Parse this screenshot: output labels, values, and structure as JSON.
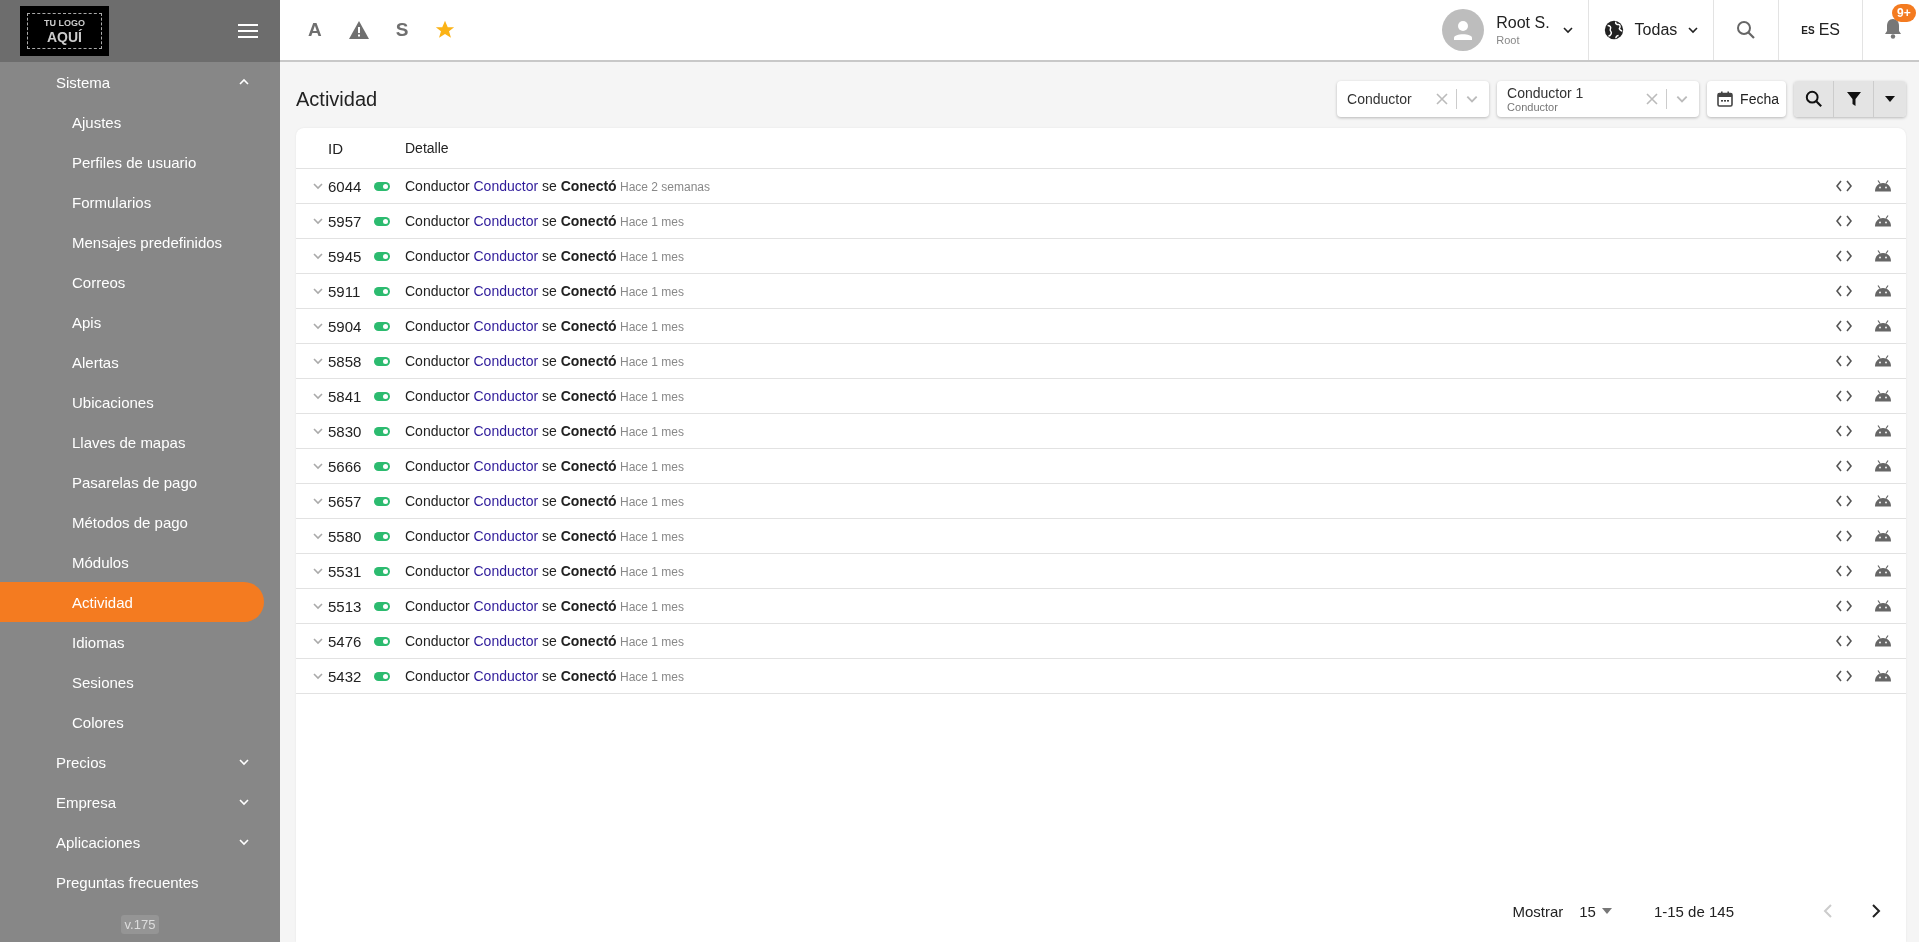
{
  "sidebar": {
    "logo": [
      "TU LOGO",
      "AQUÍ"
    ],
    "items": [
      {
        "kind": "group",
        "label": "Sistema",
        "expanded": true,
        "children": [
          {
            "label": "Ajustes",
            "selected": false
          },
          {
            "label": "Perfiles de usuario",
            "selected": false
          },
          {
            "label": "Formularios",
            "selected": false
          },
          {
            "label": "Mensajes predefinidos",
            "selected": false
          },
          {
            "label": "Correos",
            "selected": false
          },
          {
            "label": "Apis",
            "selected": false
          },
          {
            "label": "Alertas",
            "selected": false
          },
          {
            "label": "Ubicaciones",
            "selected": false
          },
          {
            "label": "Llaves de mapas",
            "selected": false
          },
          {
            "label": "Pasarelas de pago",
            "selected": false
          },
          {
            "label": "Métodos de pago",
            "selected": false
          },
          {
            "label": "Módulos",
            "selected": false
          },
          {
            "label": "Actividad",
            "selected": true
          },
          {
            "label": "Idiomas",
            "selected": false
          },
          {
            "label": "Sesiones",
            "selected": false
          },
          {
            "label": "Colores",
            "selected": false
          }
        ]
      },
      {
        "kind": "group",
        "label": "Precios",
        "expanded": false
      },
      {
        "kind": "group",
        "label": "Empresa",
        "expanded": false
      },
      {
        "kind": "group",
        "label": "Aplicaciones",
        "expanded": false
      },
      {
        "kind": "link",
        "label": "Preguntas frecuentes"
      }
    ],
    "version": "v.175"
  },
  "topbar": {
    "shortcuts": [
      {
        "kind": "letter",
        "label": "A"
      },
      {
        "kind": "warning"
      },
      {
        "kind": "letter",
        "label": "S"
      },
      {
        "kind": "star"
      }
    ],
    "user": {
      "name": "Root S.",
      "role": "Root"
    },
    "region": "Todas",
    "language": {
      "code": "ES",
      "label": "ES"
    },
    "notifications": {
      "badge": "9+"
    }
  },
  "page_title": "Actividad",
  "filters": [
    {
      "value": "Conductor"
    },
    {
      "value": "Conductor 1",
      "sublabel": "Conductor"
    }
  ],
  "date_button": "Fecha",
  "table": {
    "columns": [
      "ID",
      "Detalle"
    ],
    "rows": [
      {
        "id": "6044",
        "on": true,
        "subject": "Conductor",
        "name": "Conductor",
        "verb": "se",
        "action": "Conectó",
        "time": "Hace 2 semanas"
      },
      {
        "id": "5957",
        "on": true,
        "subject": "Conductor",
        "name": "Conductor",
        "verb": "se",
        "action": "Conectó",
        "time": "Hace 1 mes"
      },
      {
        "id": "5945",
        "on": true,
        "subject": "Conductor",
        "name": "Conductor",
        "verb": "se",
        "action": "Conectó",
        "time": "Hace 1 mes"
      },
      {
        "id": "5911",
        "on": true,
        "subject": "Conductor",
        "name": "Conductor",
        "verb": "se",
        "action": "Conectó",
        "time": "Hace 1 mes"
      },
      {
        "id": "5904",
        "on": true,
        "subject": "Conductor",
        "name": "Conductor",
        "verb": "se",
        "action": "Conectó",
        "time": "Hace 1 mes"
      },
      {
        "id": "5858",
        "on": true,
        "subject": "Conductor",
        "name": "Conductor",
        "verb": "se",
        "action": "Conectó",
        "time": "Hace 1 mes"
      },
      {
        "id": "5841",
        "on": true,
        "subject": "Conductor",
        "name": "Conductor",
        "verb": "se",
        "action": "Conectó",
        "time": "Hace 1 mes"
      },
      {
        "id": "5830",
        "on": true,
        "subject": "Conductor",
        "name": "Conductor",
        "verb": "se",
        "action": "Conectó",
        "time": "Hace 1 mes"
      },
      {
        "id": "5666",
        "on": true,
        "subject": "Conductor",
        "name": "Conductor",
        "verb": "se",
        "action": "Conectó",
        "time": "Hace 1 mes"
      },
      {
        "id": "5657",
        "on": true,
        "subject": "Conductor",
        "name": "Conductor",
        "verb": "se",
        "action": "Conectó",
        "time": "Hace 1 mes"
      },
      {
        "id": "5580",
        "on": true,
        "subject": "Conductor",
        "name": "Conductor",
        "verb": "se",
        "action": "Conectó",
        "time": "Hace 1 mes"
      },
      {
        "id": "5531",
        "on": true,
        "subject": "Conductor",
        "name": "Conductor",
        "verb": "se",
        "action": "Conectó",
        "time": "Hace 1 mes"
      },
      {
        "id": "5513",
        "on": true,
        "subject": "Conductor",
        "name": "Conductor",
        "verb": "se",
        "action": "Conectó",
        "time": "Hace 1 mes"
      },
      {
        "id": "5476",
        "on": true,
        "subject": "Conductor",
        "name": "Conductor",
        "verb": "se",
        "action": "Conectó",
        "time": "Hace 1 mes"
      },
      {
        "id": "5432",
        "on": true,
        "subject": "Conductor",
        "name": "Conductor",
        "verb": "se",
        "action": "Conectó",
        "time": "Hace 1 mes"
      }
    ]
  },
  "pagination": {
    "label": "Mostrar",
    "page_size": "15",
    "range": "1-15 de 145",
    "prev_disabled": true,
    "next_disabled": false
  }
}
